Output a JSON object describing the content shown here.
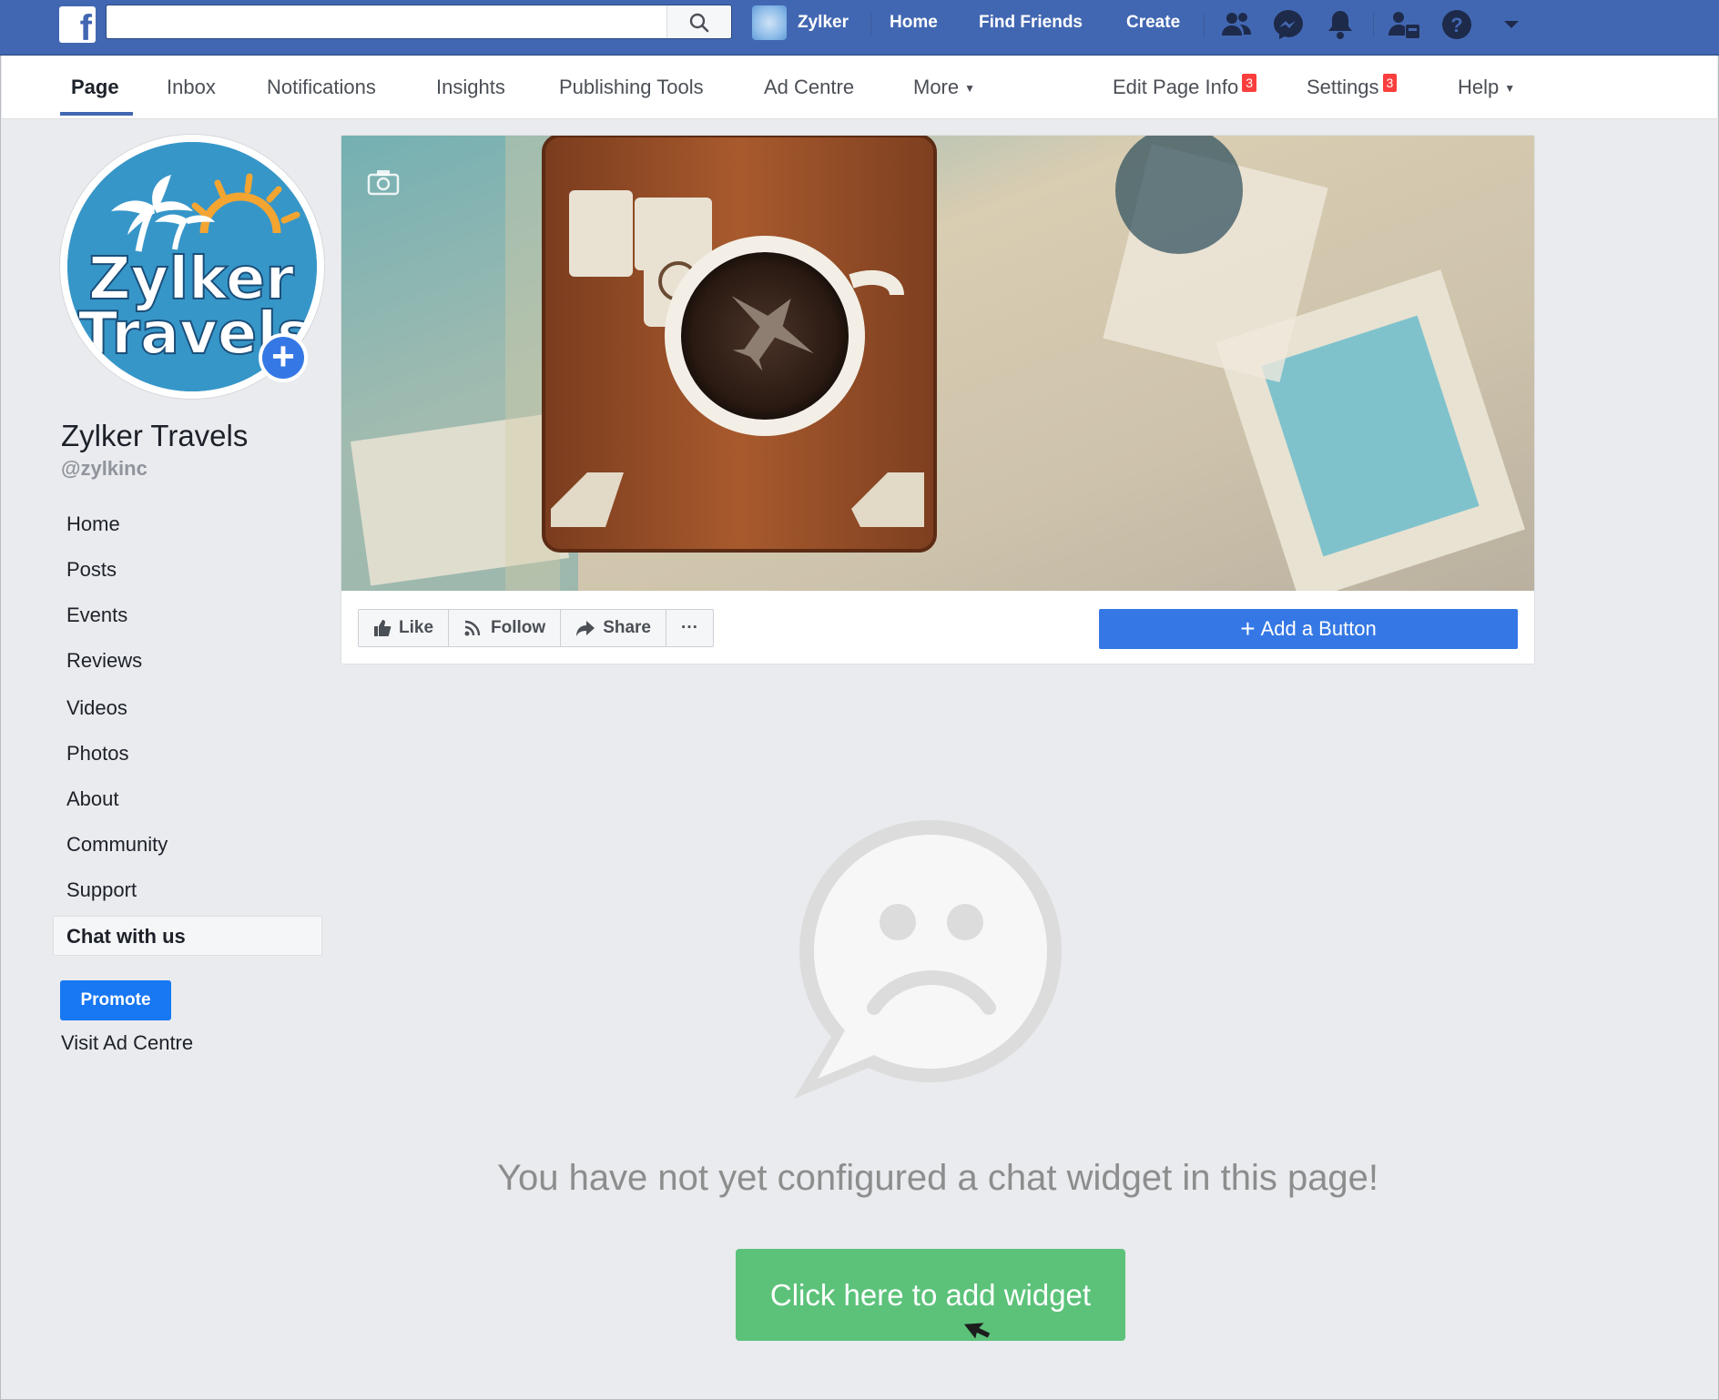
{
  "topbar": {
    "logo_letter": "f",
    "search": {
      "value": "",
      "placeholder": ""
    },
    "user_name": "Zylker",
    "links": [
      "Home",
      "Find Friends",
      "Create"
    ],
    "icons": [
      "friends-icon",
      "messenger-icon",
      "notifications-icon",
      "page-roles-icon",
      "help-icon",
      "account-menu-caret-icon"
    ]
  },
  "pagenav": {
    "tabs": [
      "Page",
      "Inbox",
      "Notifications",
      "Insights",
      "Publishing Tools",
      "Ad Centre",
      "More"
    ],
    "active_tab": "Page",
    "edit_page_info": "Edit Page Info",
    "edit_page_info_badge": "3",
    "settings": "Settings",
    "settings_badge": "3",
    "help": "Help"
  },
  "profile": {
    "logo_text_line1": "Zylker",
    "logo_text_line2": "Travels",
    "name": "Zylker Travels",
    "handle": "@zylkinc"
  },
  "sidebar": {
    "items": [
      "Home",
      "Posts",
      "Events",
      "Reviews",
      "Videos",
      "Photos",
      "About",
      "Community",
      "Support"
    ],
    "active_item": "Chat with us",
    "promote": "Promote",
    "visit_ad_centre": "Visit Ad Centre"
  },
  "cover_actions": {
    "like": "Like",
    "follow": "Follow",
    "share": "Share",
    "more": "···",
    "add_button": "Add a Button"
  },
  "empty_state": {
    "message": "You have not yet configured a chat widget in this page!",
    "cta": "Click here to add widget"
  },
  "colors": {
    "facebook_blue": "#4267b2",
    "primary_button": "#3578e5",
    "promote_button": "#1877f2",
    "cta_green": "#5cc27a",
    "page_background": "#e9ebee",
    "badge_red": "#fa3e3e"
  }
}
